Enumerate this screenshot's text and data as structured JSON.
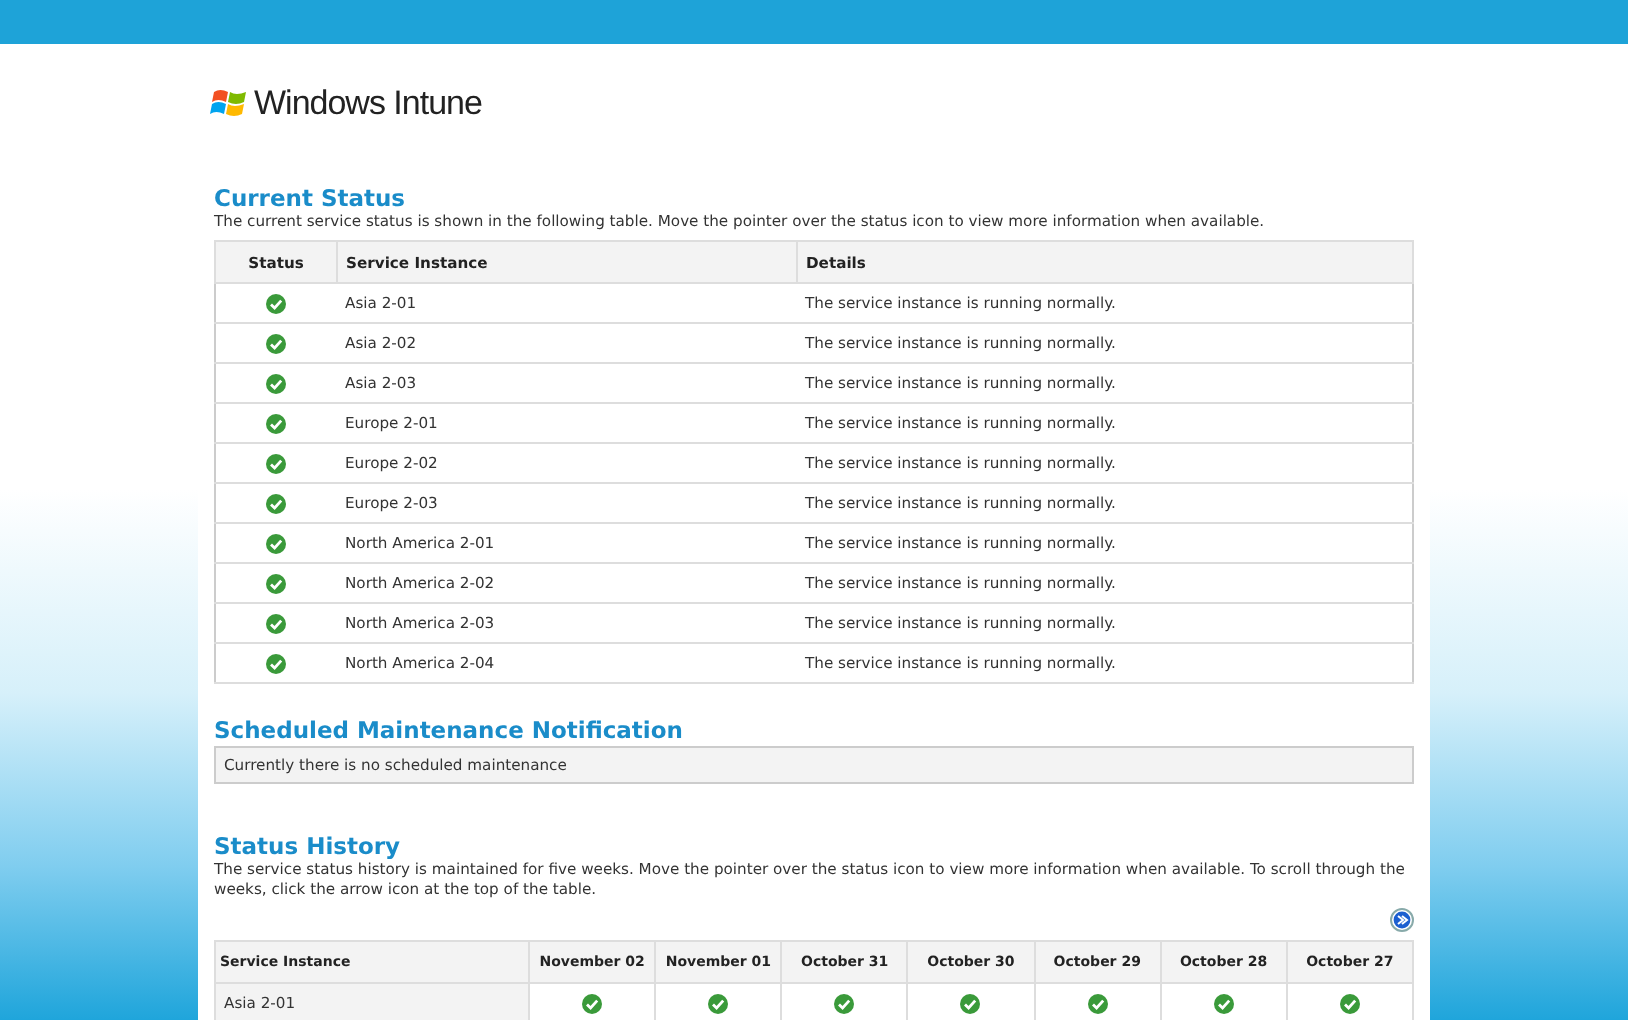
{
  "logo": {
    "text": "Windows Intune"
  },
  "current_status": {
    "title": "Current Status",
    "description": "The current service status is shown in the following table. Move the pointer over the status icon to view more information when available.",
    "columns": [
      "Status",
      "Service Instance",
      "Details"
    ],
    "rows": [
      {
        "healthy": true,
        "instance": "Asia 2-01",
        "details": "The service instance is running normally."
      },
      {
        "healthy": true,
        "instance": "Asia 2-02",
        "details": "The service instance is running normally."
      },
      {
        "healthy": true,
        "instance": "Asia 2-03",
        "details": "The service instance is running normally."
      },
      {
        "healthy": true,
        "instance": "Europe 2-01",
        "details": "The service instance is running normally."
      },
      {
        "healthy": true,
        "instance": "Europe 2-02",
        "details": "The service instance is running normally."
      },
      {
        "healthy": true,
        "instance": "Europe 2-03",
        "details": "The service instance is running normally."
      },
      {
        "healthy": true,
        "instance": "North America 2-01",
        "details": "The service instance is running normally."
      },
      {
        "healthy": true,
        "instance": "North America 2-02",
        "details": "The service instance is running normally."
      },
      {
        "healthy": true,
        "instance": "North America 2-03",
        "details": "The service instance is running normally."
      },
      {
        "healthy": true,
        "instance": "North America 2-04",
        "details": "The service instance is running normally."
      }
    ]
  },
  "maintenance": {
    "title": "Scheduled Maintenance Notification",
    "message": "Currently there is no scheduled maintenance"
  },
  "history": {
    "title": "Status History",
    "description": "The service status history is maintained for five weeks. Move the pointer over the status icon to view more information when available. To scroll through the weeks, click the arrow icon at the top of the table.",
    "columns": [
      "Service Instance",
      "November 02",
      "November 01",
      "October 31",
      "October 30",
      "October 29",
      "October 28",
      "October 27"
    ],
    "rows": [
      {
        "instance": "Asia 2-01",
        "days": [
          {
            "healthy": true
          },
          {
            "healthy": true
          },
          {
            "healthy": true
          },
          {
            "healthy": true
          },
          {
            "healthy": true
          },
          {
            "healthy": true
          },
          {
            "healthy": true
          }
        ]
      }
    ]
  }
}
